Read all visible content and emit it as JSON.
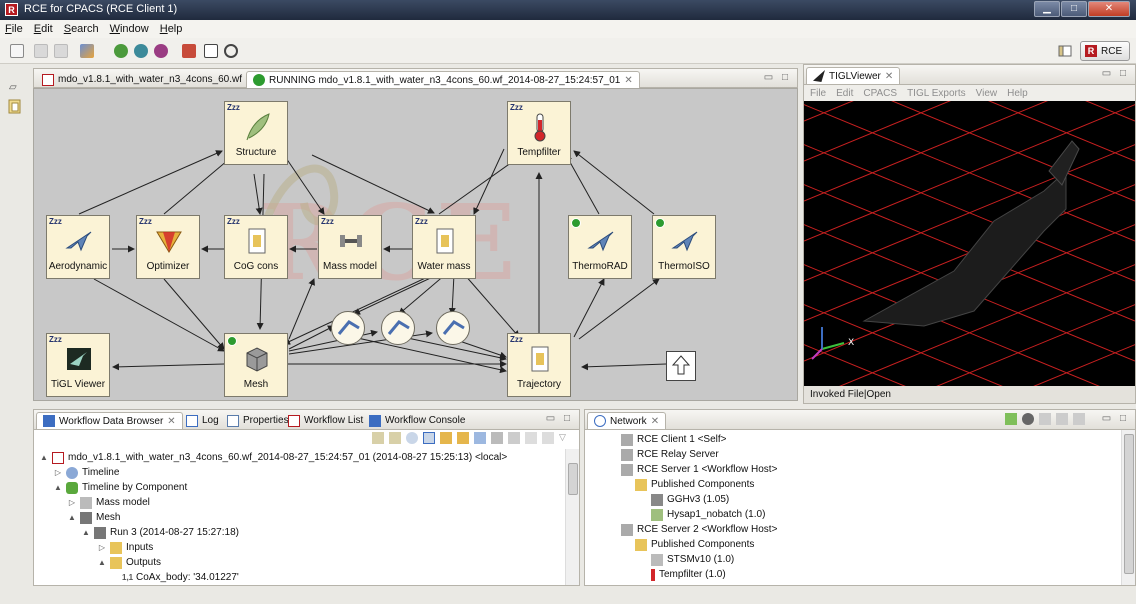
{
  "window": {
    "title": "RCE for CPACS (RCE Client 1)",
    "app_icon_letter": "R"
  },
  "menu": [
    "File",
    "Edit",
    "Search",
    "Window",
    "Help"
  ],
  "toolbar": {
    "perspective_label": "RCE",
    "perspective_icon_letter": "R"
  },
  "editor_tabs": [
    {
      "label": "mdo_v1.8.1_with_water_n3_4cons_60.wf"
    },
    {
      "label": "RUNNING mdo_v1.8.1_with_water_n3_4cons_60.wf_2014-08-27_15:24:57_01"
    }
  ],
  "workflow": {
    "watermark": "RCE",
    "nodes": [
      {
        "id": "structure",
        "label": "Structure",
        "state": "Zzz"
      },
      {
        "id": "tempfilter",
        "label": "Tempfilter",
        "state": "Zzz"
      },
      {
        "id": "aerodynamic",
        "label": "Aerodynamic",
        "state": "Zzz"
      },
      {
        "id": "optimizer",
        "label": "Optimizer",
        "state": "Zzz"
      },
      {
        "id": "cog",
        "label": "CoG cons",
        "state": "Zzz"
      },
      {
        "id": "massmodel",
        "label": "Mass model",
        "state": "Zzz"
      },
      {
        "id": "watermass",
        "label": "Water mass",
        "state": "Zzz"
      },
      {
        "id": "thermorad",
        "label": "ThermoRAD",
        "state": "running"
      },
      {
        "id": "thermoiso",
        "label": "ThermoISO",
        "state": "running"
      },
      {
        "id": "tiglviewer",
        "label": "TiGL Viewer",
        "state": "Zzz"
      },
      {
        "id": "mesh",
        "label": "Mesh",
        "state": "running"
      },
      {
        "id": "trajectory",
        "label": "Trajectory",
        "state": "Zzz"
      }
    ]
  },
  "tigl": {
    "tab_label": "TIGLViewer",
    "menu": [
      "File",
      "Edit",
      "CPACS",
      "TIGL Exports",
      "View",
      "Help"
    ],
    "axis_x": "X",
    "status": "Invoked File|Open"
  },
  "bottom_tabs": [
    "Workflow Data Browser",
    "Log",
    "Properties",
    "Workflow List",
    "Workflow Console"
  ],
  "data_browser": {
    "rows": [
      {
        "text": "mdo_v1.8.1_with_water_n3_4cons_60.wf_2014-08-27_15:24:57_01 (2014-08-27 15:25:13) <local>",
        "twisty": "▲"
      },
      {
        "text": "Timeline",
        "twisty": "▷"
      },
      {
        "text": "Timeline by Component",
        "twisty": "▲"
      },
      {
        "text": "Mass model",
        "twisty": "▷"
      },
      {
        "text": "Mesh",
        "twisty": "▲"
      },
      {
        "text": "Run 3 (2014-08-27 15:27:18)",
        "twisty": "▲"
      },
      {
        "text": "Inputs",
        "twisty": "▷"
      },
      {
        "text": "Outputs",
        "twisty": "▲"
      },
      {
        "text": "CoAx_body: '34.01227'",
        "twisty": ""
      }
    ]
  },
  "network": {
    "tab_label": "Network",
    "rows": [
      {
        "text": "RCE Client 1 <Self>"
      },
      {
        "text": "RCE Relay Server"
      },
      {
        "text": "RCE Server 1 <Workflow Host>"
      },
      {
        "text": "Published Components"
      },
      {
        "text": "GGHv3 (1.05)"
      },
      {
        "text": "Hysap1_nobatch (1.0)"
      },
      {
        "text": "RCE Server 2 <Workflow Host>"
      },
      {
        "text": "Published Components"
      },
      {
        "text": "STSMv10 (1.0)"
      },
      {
        "text": "Tempfilter (1.0)"
      }
    ]
  },
  "colors": {
    "canvas": "#c8c8c8",
    "node_fill": "#fbf3d6",
    "running": "#2d9b2f",
    "rce_red": "#b51a20",
    "grid_red": "#d22020"
  }
}
